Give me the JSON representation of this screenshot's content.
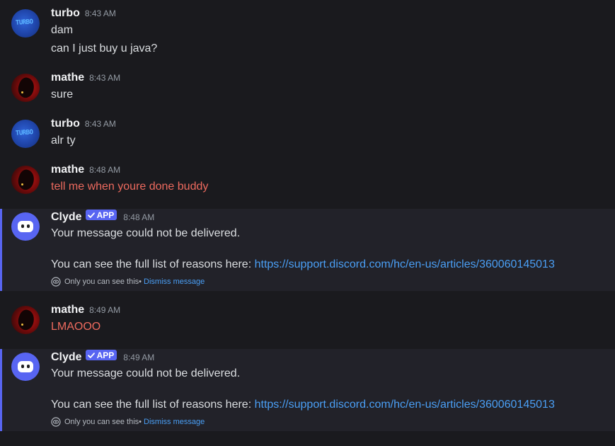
{
  "messages": [
    {
      "author": "turbo",
      "time": "8:43 AM",
      "avatar_text": "TURBO",
      "lines": [
        "dam",
        "can I just buy u java?"
      ]
    },
    {
      "author": "mathe",
      "time": "8:43 AM",
      "lines": [
        "sure"
      ]
    },
    {
      "author": "turbo",
      "time": "8:43 AM",
      "avatar_text": "TURBO",
      "lines": [
        "alr ty"
      ]
    },
    {
      "author": "mathe",
      "time": "8:48 AM",
      "lines": [
        "tell me when youre done buddy"
      ]
    },
    {
      "author": "Clyde",
      "badge": "APP",
      "time": "8:48 AM",
      "line1": "Your message could not be delivered.",
      "line2_prefix": "You can see the full list of reasons here: ",
      "link": "https://support.discord.com/hc/en-us/articles/360060145013",
      "footer_text": "Only you can see this",
      "footer_sep": " •",
      "dismiss": "Dismiss message"
    },
    {
      "author": "mathe",
      "time": "8:49 AM",
      "lines": [
        "LMAOOO"
      ]
    },
    {
      "author": "Clyde",
      "badge": "APP",
      "time": "8:49 AM",
      "line1": "Your message could not be delivered.",
      "line2_prefix": "You can see the full list of reasons here: ",
      "link": "https://support.discord.com/hc/en-us/articles/360060145013",
      "footer_text": "Only you can see this",
      "footer_sep": " •",
      "dismiss": "Dismiss message"
    }
  ],
  "colors": {
    "background": "#1a1a1e",
    "ephemeral_bg": "#222229",
    "accent": "#5865f2",
    "failed_text": "#ed6a5e",
    "link": "#4a9ff5"
  },
  "icons": {
    "badge_check": "check-icon",
    "footer_eye": "eye-icon"
  }
}
